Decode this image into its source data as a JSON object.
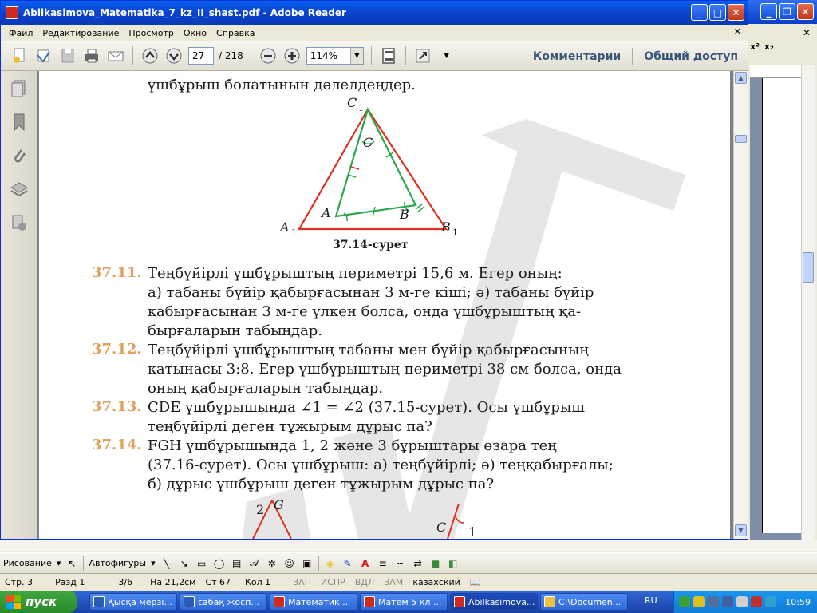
{
  "reader": {
    "title": "Abilkasimova_Matematika_7_kz_II_shast.pdf - Adobe Reader",
    "menu": [
      "Файл",
      "Редактирование",
      "Просмотр",
      "Окно",
      "Справка"
    ],
    "page_current": "27",
    "page_total": "/ 218",
    "zoom": "114%",
    "comments_label": "Комментарии",
    "share_label": "Общий доступ"
  },
  "pdf": {
    "top_line": "үшбұрыш болатынын дәлелдеңдер.",
    "figure_caption": "37.14-сурет",
    "figure_labels": {
      "c1": "C",
      "c1_sub": "1",
      "c": "C",
      "a": "A",
      "b": "B",
      "a1": "A",
      "a1_sub": "1",
      "b1": "B",
      "b1_sub": "1"
    },
    "problems": [
      {
        "num": "37.11.",
        "lines": [
          "Теңбүйірлі үшбұрыштың периметрі 15,6 м. Егер оның:",
          "а) табаны бүйір қабырғасынан 3 м-ге кіші; ә) табаны бүйір",
          "қабырғасынан 3 м-ге үлкен болса, онда үшбұрыштың қа-",
          "бырғаларын табыңдар."
        ]
      },
      {
        "num": "37.12.",
        "lines": [
          "Теңбүйірлі үшбұрыштың табаны мен бүйір қабырғасының",
          "қатынасы 3:8. Егер үшбұрыштың периметрі 38 см болса, онда",
          "оның қабырғаларын табыңдар."
        ]
      },
      {
        "num": "37.13.",
        "lines": [
          "CDE үшбұрышында ∠1 = ∠2 (37.15-сурет). Осы үшбұрыш",
          "теңбүйірлі деген тұжырым дұрыс па?"
        ]
      },
      {
        "num": "37.14.",
        "lines": [
          "FGH үшбұрышында 1, 2 және 3 бұрыштары өзара тең",
          "(37.16-сурет). Осы үшбұрыш: а) теңбүйірлі; ә) теңқабырғалы;",
          "б) дұрыс үшбұрыш деген тұжырым дұрыс па?"
        ]
      }
    ],
    "bottom_labels": {
      "two": "2",
      "g": "G",
      "c": "C",
      "one": "1"
    }
  },
  "word": {
    "format_x2": "x²",
    "format_x_2": "x₂",
    "drawing_menu": "Рисование",
    "autoshapes": "Автофигуры",
    "status": {
      "page": "Стр. 3",
      "section": "Разд 1",
      "pages": "3/6",
      "at": "На 21,2см",
      "line": "Ст 67",
      "col": "Кол 1",
      "rec": "ЗАП",
      "trk": "ИСПР",
      "ext": "ВДЛ",
      "ovr": "ЗАМ",
      "lang": "казахский"
    }
  },
  "taskbar": {
    "start_label": "пуск",
    "items": [
      "Қысқа мерзі...",
      "сабақ жосп...",
      "Математик...",
      "Матем 5 кл ...",
      "Abilkasimova...",
      "C:\\Documen..."
    ],
    "lang": "RU",
    "clock": "10:59"
  },
  "colors": {
    "title_blue": "#0a3fc8",
    "triangle_red": "#e03020",
    "triangle_green": "#2aa84a",
    "number_orange": "#e0a060"
  }
}
